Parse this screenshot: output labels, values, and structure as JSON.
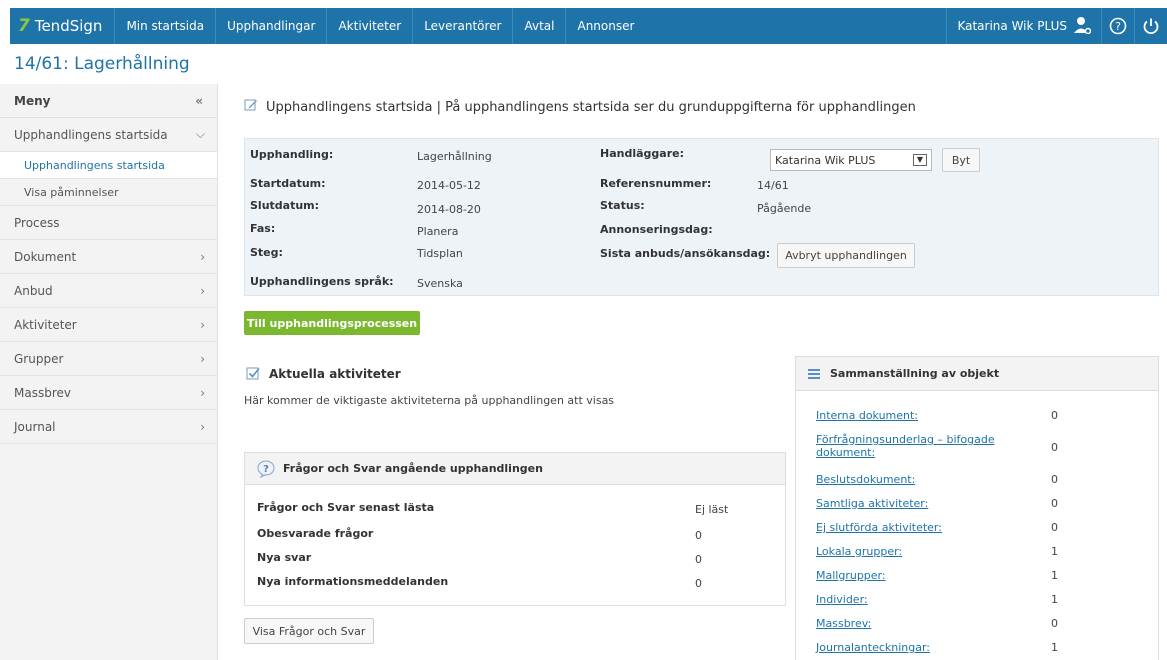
{
  "brand": "TendSign",
  "nav": {
    "items": [
      "Min startsida",
      "Upphandlingar",
      "Aktiviteter",
      "Leverantörer",
      "Avtal",
      "Annonser"
    ],
    "user": "Katarina Wik PLUS",
    "user_icon": "user-icon",
    "help_icon": "help-icon",
    "power_icon": "power-icon"
  },
  "page_title": "14/61: Lagerhållning",
  "sidebar": {
    "header": "Meny",
    "collapse_icon": "«",
    "items": [
      {
        "label": "Upphandlingens startsida",
        "chevron": "down"
      },
      {
        "label": "Upphandlingens startsida",
        "sub": true,
        "active": true
      },
      {
        "label": "Visa påminnelser",
        "sub": true
      },
      {
        "label": "Process"
      },
      {
        "label": "Dokument",
        "chevron": "right"
      },
      {
        "label": "Anbud",
        "chevron": "right"
      },
      {
        "label": "Aktiviteter",
        "chevron": "right"
      },
      {
        "label": "Grupper",
        "chevron": "right"
      },
      {
        "label": "Massbrev",
        "chevron": "right"
      },
      {
        "label": "Journal",
        "chevron": "right"
      }
    ]
  },
  "main": {
    "heading": "Upphandlingens startsida  |  På upphandlingens startsida ser du grunduppgifterna för upphandlingen",
    "info": {
      "upphandling_label": "Upphandling:",
      "upphandling": "Lagerhållning",
      "startdatum_label": "Startdatum:",
      "startdatum": "2014-05-12",
      "slutdatum_label": "Slutdatum:",
      "slutdatum": "2014-08-20",
      "fas_label": "Fas:",
      "fas": "Planera",
      "steg_label": "Steg:",
      "steg": "Tidsplan",
      "sprak_label": "Upphandlingens språk:",
      "sprak": "Svenska",
      "handlaggare_label": "Handläggare:",
      "handlaggare": "Katarina Wik PLUS",
      "byt": "Byt",
      "referens_label": "Referensnummer:",
      "referens": "14/61",
      "status_label": "Status:",
      "status": "Pågående",
      "annons_label": "Annonseringsdag:",
      "sista_label": "Sista anbuds/ansökansdag:",
      "avbryt": "Avbryt upphandlingen"
    },
    "process_button": "Till upphandlingsprocessen",
    "activities_title": "Aktuella aktiviteter",
    "activities_text": "Här kommer de viktigaste aktiviteterna på upphandlingen att visas",
    "qa": {
      "title": "Frågor och Svar angående upphandlingen",
      "rows": [
        {
          "label": "Frågor och Svar senast lästa",
          "value": "Ej läst"
        },
        {
          "label": "Obesvarade frågor",
          "value": "0"
        },
        {
          "label": "Nya svar",
          "value": "0"
        },
        {
          "label": "Nya informationsmeddelanden",
          "value": "0"
        }
      ],
      "button": "Visa Frågor och Svar"
    },
    "summary": {
      "title": "Sammanställning av objekt",
      "rows": [
        {
          "label": "Interna dokument:",
          "value": "0"
        },
        {
          "label": "Förfrågningsunderlag – bifogade dokument:",
          "value": "0"
        },
        {
          "label": "Beslutsdokument:",
          "value": "0"
        },
        {
          "label": "Samtliga aktiviteter:",
          "value": "0"
        },
        {
          "label": "Ej slutförda aktiviteter:",
          "value": "0"
        },
        {
          "label": "Lokala grupper:",
          "value": "1"
        },
        {
          "label": "Mallgrupper:",
          "value": "1"
        },
        {
          "label": "Individer:",
          "value": "1"
        },
        {
          "label": "Massbrev:",
          "value": "0"
        },
        {
          "label": "Journalanteckningar:",
          "value": "1"
        }
      ]
    }
  }
}
